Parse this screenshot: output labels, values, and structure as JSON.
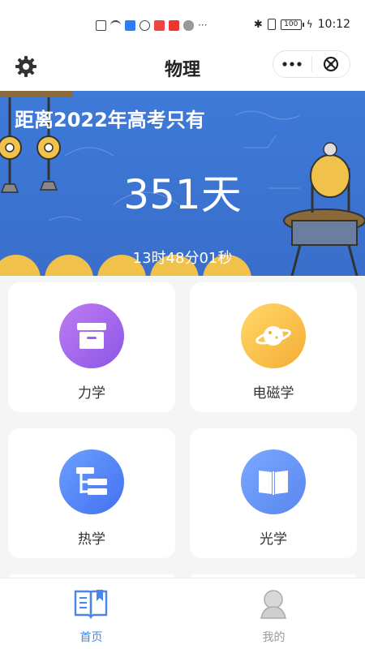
{
  "status_bar": {
    "battery": "100",
    "time": "10:12"
  },
  "header": {
    "title": "物理",
    "more_icon": "more-dots-icon",
    "close_icon": "close-circle-icon",
    "settings_icon": "gear-icon"
  },
  "banner": {
    "caption": "距离2022年高考只有",
    "days": "351天",
    "time_left": "13时48分01秒"
  },
  "subjects": [
    {
      "label": "力学",
      "icon": "box-icon",
      "color_from": "#c07cf2",
      "color_to": "#8a57e6"
    },
    {
      "label": "电磁学",
      "icon": "planet-icon",
      "color_from": "#ffd86a",
      "color_to": "#f4ad33"
    },
    {
      "label": "热学",
      "icon": "tree-structure-icon",
      "color_from": "#6aa0ff",
      "color_to": "#4470ef"
    },
    {
      "label": "光学",
      "icon": "book-icon",
      "color_from": "#7aa8ff",
      "color_to": "#5a86f0"
    }
  ],
  "tabbar": {
    "tabs": [
      {
        "label": "首页",
        "icon": "home-book-icon",
        "active": true,
        "color": "#4a86e8"
      },
      {
        "label": "我的",
        "icon": "profile-icon",
        "active": false,
        "color": "#999999"
      }
    ]
  }
}
